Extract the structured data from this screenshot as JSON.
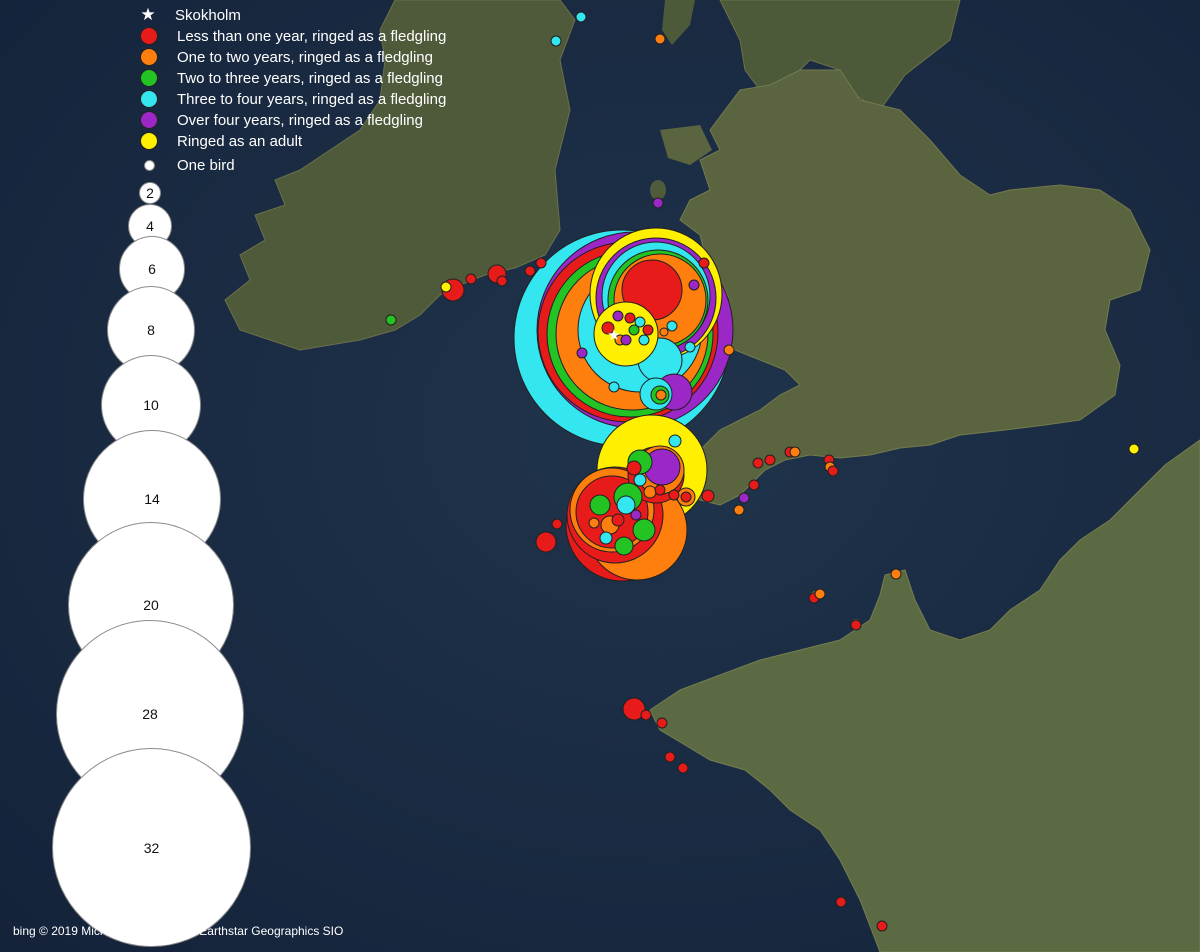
{
  "legend": {
    "site_label": "Skokholm",
    "categories": [
      {
        "label": "Less than one year, ringed as a fledgling",
        "color": "#e81b1b"
      },
      {
        "label": "One to two years, ringed as a fledgling",
        "color": "#ff7f0e"
      },
      {
        "label": "Two to three years, ringed as a fledgling",
        "color": "#22c322"
      },
      {
        "label": "Three to four years, ringed as a fledgling",
        "color": "#34e6f0"
      },
      {
        "label": "Over four years, ringed as a fledgling",
        "color": "#9b27c7"
      },
      {
        "label": "Ringed as an adult",
        "color": "#ffef00"
      }
    ],
    "one_bird_label": "One bird",
    "sizes": [
      "2",
      "4",
      "6",
      "8",
      "10",
      "14",
      "20",
      "28",
      "32"
    ]
  },
  "attribution": "bing © 2019 Microsoft Corporation Earthstar Geographics SIO"
}
